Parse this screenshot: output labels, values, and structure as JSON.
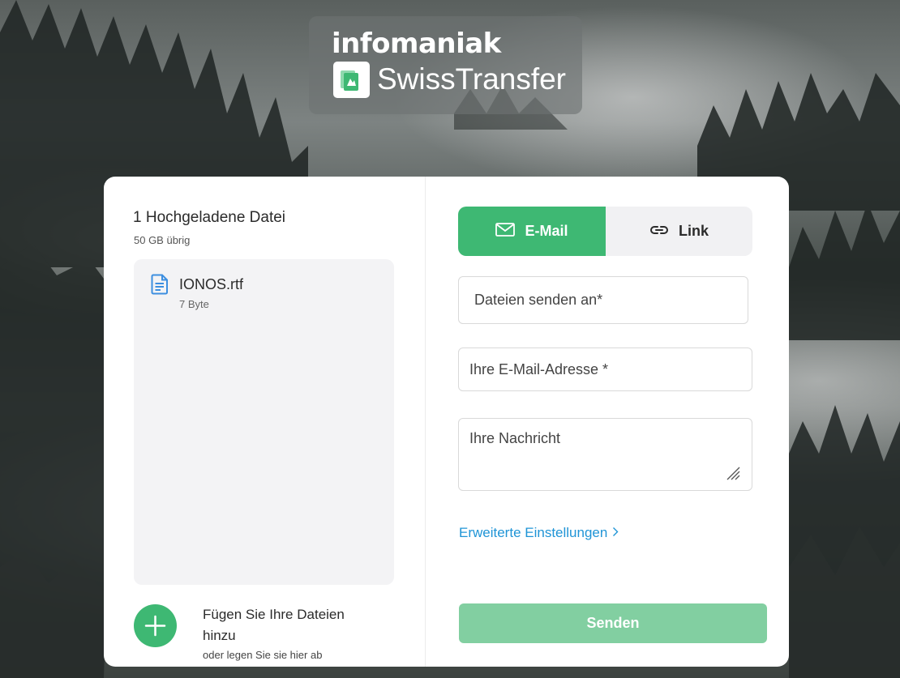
{
  "brand": {
    "company": "infomaniak",
    "product": "SwissTransfer"
  },
  "files": {
    "title": "1 Hochgeladene Datei",
    "remaining": "50 GB übrig",
    "items": [
      {
        "name": "IONOS.rtf",
        "size": "7 Byte",
        "icon": "document-icon"
      }
    ],
    "add_label": "Fügen Sie Ihre Dateien hinzu",
    "add_sub": "oder legen Sie sie hier ab"
  },
  "tabs": [
    {
      "label": "E-Mail",
      "icon": "envelope-icon",
      "active": true
    },
    {
      "label": "Link",
      "icon": "link-icon",
      "active": false
    }
  ],
  "form": {
    "recipients_placeholder": "Dateien senden an*",
    "sender_placeholder": "Ihre E-Mail-Adresse *",
    "message_placeholder": "Ihre Nachricht",
    "advanced_label": "Erweiterte Einstellungen",
    "send_label": "Senden"
  },
  "colors": {
    "accent": "#3eb873",
    "accent_disabled": "#82cfa1",
    "link": "#1f94d6",
    "file_icon": "#3d8fe0"
  }
}
